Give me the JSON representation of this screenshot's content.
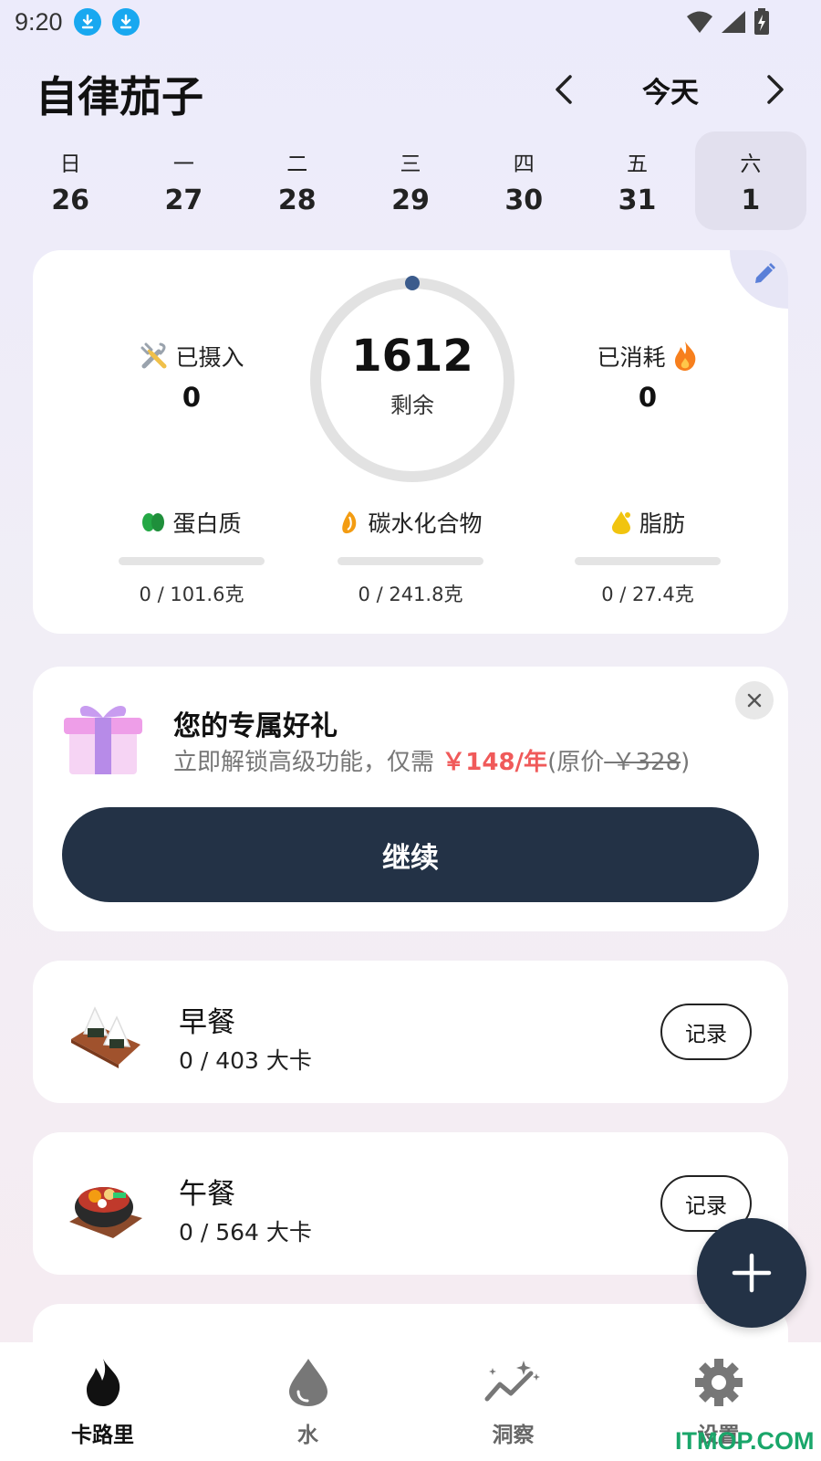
{
  "status_bar": {
    "time": "9:20"
  },
  "header": {
    "title": "自律茄子",
    "date_label": "今天"
  },
  "week": [
    {
      "name": "日",
      "num": "26"
    },
    {
      "name": "一",
      "num": "27"
    },
    {
      "name": "二",
      "num": "28"
    },
    {
      "name": "三",
      "num": "29"
    },
    {
      "name": "四",
      "num": "30"
    },
    {
      "name": "五",
      "num": "31"
    },
    {
      "name": "六",
      "num": "1"
    }
  ],
  "summary": {
    "intake_label": "已摄入",
    "intake_value": "0",
    "burned_label": "已消耗",
    "burned_value": "0",
    "remaining_value": "1612",
    "remaining_label": "剩余",
    "macros": [
      {
        "label": "蛋白质",
        "value": "0 / 101.6克",
        "progress": 0
      },
      {
        "label": "碳水化合物",
        "value": "0 / 241.8克",
        "progress": 0
      },
      {
        "label": "脂肪",
        "value": "0 / 27.4克",
        "progress": 0
      }
    ]
  },
  "promo": {
    "title": "您的专属好礼",
    "text_prefix": "立即解锁高级功能，仅需",
    "price": "￥148/年",
    "original_open": "(原价",
    "original_price": " ￥328",
    "original_close": ")",
    "button_label": "继续"
  },
  "meals": [
    {
      "name": "早餐",
      "kcal": "0 / 403 大卡",
      "button": "记录"
    },
    {
      "name": "午餐",
      "kcal": "0 / 564 大卡",
      "button": "记录"
    }
  ],
  "nav": [
    {
      "label": "卡路里"
    },
    {
      "label": "水"
    },
    {
      "label": "洞察"
    },
    {
      "label": "设置"
    }
  ],
  "watermark": "ITMOP.COM",
  "colors": {
    "accent": "#233246",
    "price": "#f05a5a",
    "protein": "#2bb24c",
    "carbs": "#f39c12",
    "fat": "#f1c40f"
  }
}
